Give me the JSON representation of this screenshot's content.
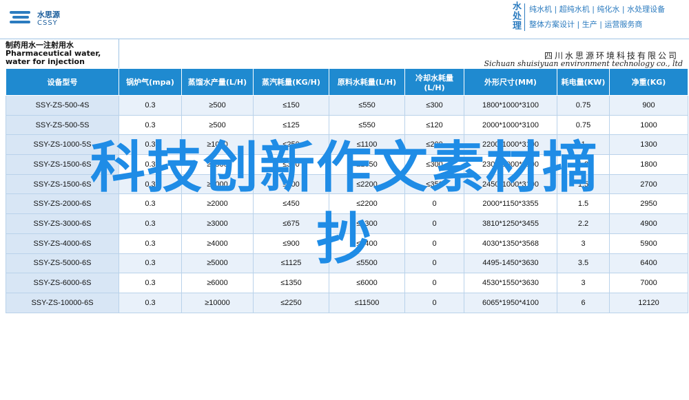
{
  "logo": {
    "name_cn": "水思源",
    "name_en": "CSSY",
    "icon": "logo-stripes-icon"
  },
  "slogan": {
    "brand": "水处理",
    "line1": "纯水机 | 超纯水机 | 纯化水 | 水处理设备",
    "line2": "整体方案设计 | 生产 | 运营服务商"
  },
  "title": {
    "left": "制药用水一注射用水 Pharmaceutical water, water for injection",
    "company_cn": "四川水思源环境科技有限公司",
    "company_en": "Sichuan shuisiyuan environment technology co., ltd"
  },
  "table": {
    "headers": [
      "设备型号",
      "锅炉气(mpa)",
      "蒸馏水产量(L/H)",
      "蒸汽耗量(KG/H)",
      "原料水耗量(L/H)",
      "冷却水耗量(L/H)",
      "外形尺寸(MM)",
      "耗电量(KW)",
      "净重(KG)"
    ],
    "rows": [
      [
        "SSY-ZS-500-4S",
        "0.3",
        "≥500",
        "≤150",
        "≤550",
        "≤300",
        "1800*1000*3100",
        "0.75",
        "900"
      ],
      [
        "SSY-ZS-500-5S",
        "0.3",
        "≥500",
        "≤125",
        "≤550",
        "≤120",
        "2000*1000*3100",
        "0.75",
        "1000"
      ],
      [
        "SSY-ZS-1000-5S",
        "0.3",
        "≥1000",
        "≤250",
        "≤1100",
        "≤200",
        "2200*1000*3100",
        "1",
        "1300"
      ],
      [
        "SSY-ZS-1500-6S",
        "0.3",
        "≥1500",
        "≤300",
        "≤1650",
        "≤300",
        "2300*1000*3100",
        "1.2",
        "1800"
      ],
      [
        "SSY-ZS-1500-6S",
        "0.3",
        "≥2000",
        "≤600",
        "≤2200",
        "≤350",
        "2450*1000*3100",
        "1.5",
        "2700"
      ],
      [
        "SSY-ZS-2000-6S",
        "0.3",
        "≥2000",
        "≤450",
        "≤2200",
        "0",
        "2000*1150*3355",
        "1.5",
        "2950"
      ],
      [
        "SSY-ZS-3000-6S",
        "0.3",
        "≥3000",
        "≤675",
        "≤3300",
        "0",
        "3810*1250*3455",
        "2.2",
        "4900"
      ],
      [
        "SSY-ZS-4000-6S",
        "0.3",
        "≥4000",
        "≤900",
        "≤4400",
        "0",
        "4030*1350*3568",
        "3",
        "5900"
      ],
      [
        "SSY-ZS-5000-6S",
        "0.3",
        "≥5000",
        "≤1125",
        "≤5500",
        "0",
        "4495-1450*3630",
        "3.5",
        "6400"
      ],
      [
        "SSY-ZS-6000-6S",
        "0.3",
        "≥6000",
        "≤1350",
        "≤6000",
        "0",
        "4530*1550*3630",
        "3",
        "7000"
      ],
      [
        "SSY-ZS-10000-6S",
        "0.3",
        "≥10000",
        "≤2250",
        "≤11500",
        "0",
        "6065*1950*4100",
        "6",
        "12120"
      ]
    ]
  },
  "overlay": {
    "line1": "科技创新作文素材摘",
    "line2": "抄"
  },
  "colors": {
    "accent": "#1f8ad0",
    "overlay": "#1f8ce6"
  }
}
